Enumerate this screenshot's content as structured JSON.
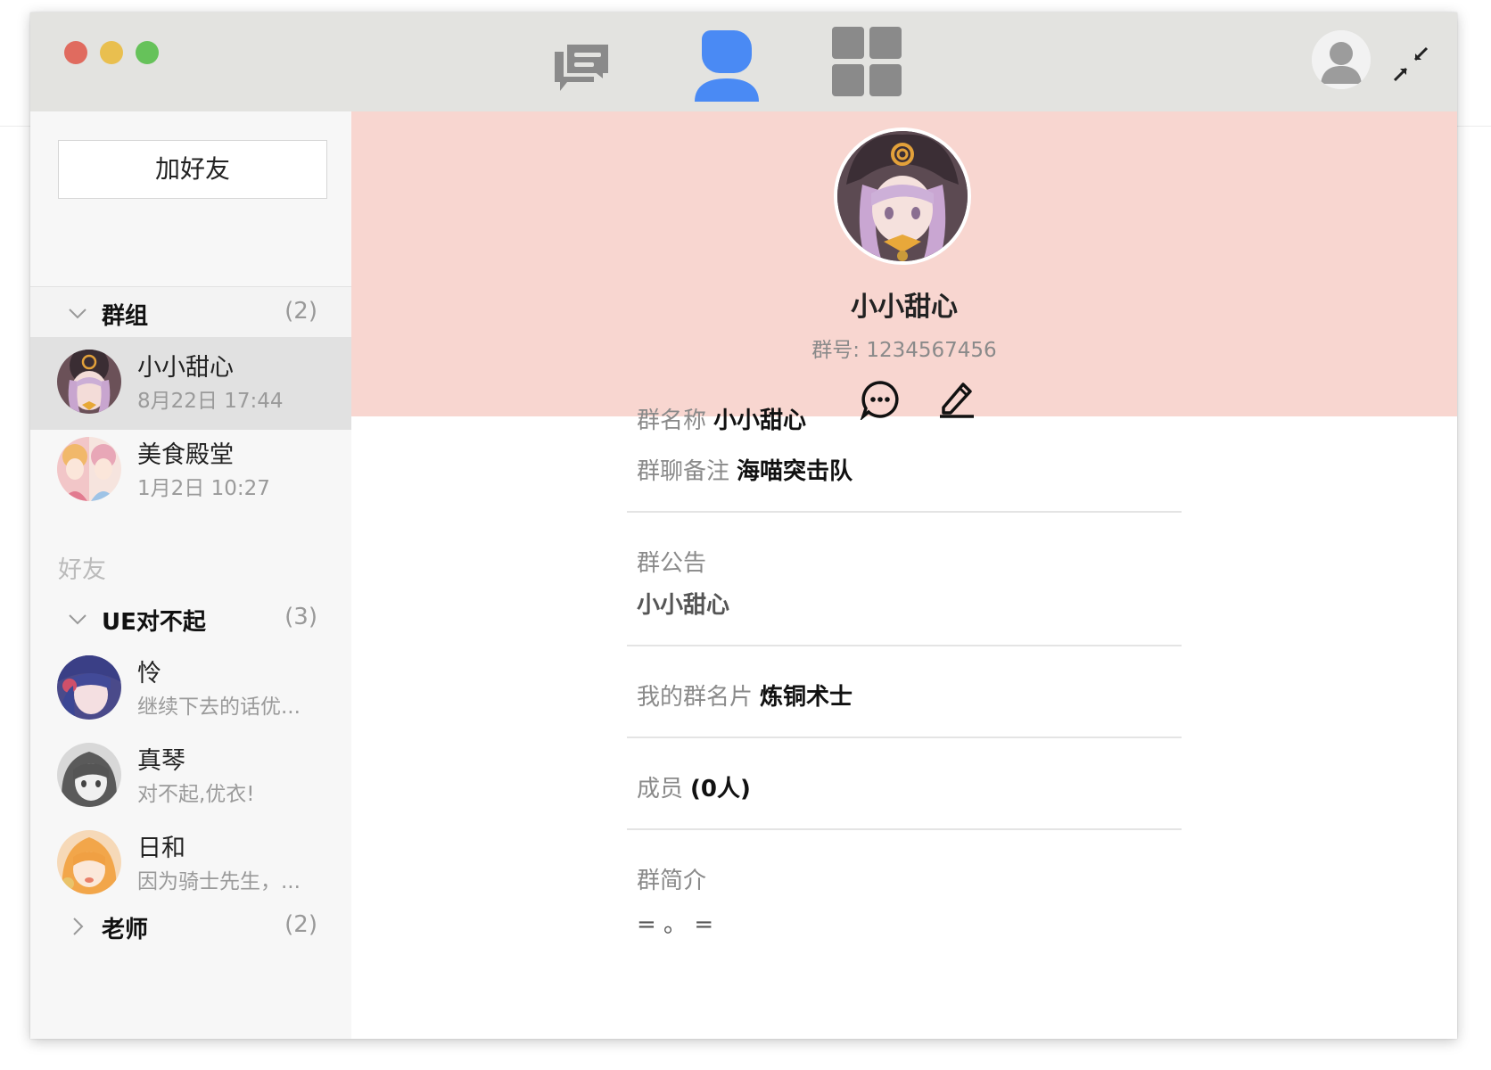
{
  "nav": {
    "tabs": [
      {
        "icon": "chat-bubbles-icon",
        "active": false
      },
      {
        "icon": "contacts-person-icon",
        "active": true
      },
      {
        "icon": "apps-grid-icon",
        "active": false
      }
    ],
    "accent_color": "#4a8af4",
    "inactive_color": "#8a8a8a"
  },
  "sidebar": {
    "add_friend_label": "加好友",
    "groups_section": {
      "name": "群组",
      "count": "(2)",
      "expanded": true
    },
    "groups": [
      {
        "name": "小小甜心",
        "time": "8月22日 17:44",
        "selected": true
      },
      {
        "name": "美食殿堂",
        "time": "1月2日 10:27",
        "selected": false
      }
    ],
    "friends_label": "好友",
    "friend_groups": [
      {
        "name": "UE对不起",
        "count": "(3)",
        "expanded": true,
        "items": [
          {
            "name": "怜",
            "message": "继续下去的话优..."
          },
          {
            "name": "真琴",
            "message": "对不起,优衣!"
          },
          {
            "name": "日和",
            "message": "因为骑士先生，..."
          }
        ]
      },
      {
        "name": "老师",
        "count": "(2)",
        "expanded": false
      }
    ]
  },
  "profile": {
    "name": "小小甜心",
    "group_id": "群号: 1234567456",
    "header_color": "#f8d6d0",
    "fields": {
      "group_name_label": "群名称",
      "group_name_value": "小小甜心",
      "remark_label": "群聊备注",
      "remark_value": "海喵突击队",
      "announcement_label": "群公告",
      "announcement_value": "小小甜心",
      "card_label": "我的群名片",
      "card_value": "炼铜术士",
      "members_label": "成员",
      "members_value": "(0人)",
      "intro_label": "群简介",
      "intro_value": "= 。 ="
    }
  }
}
